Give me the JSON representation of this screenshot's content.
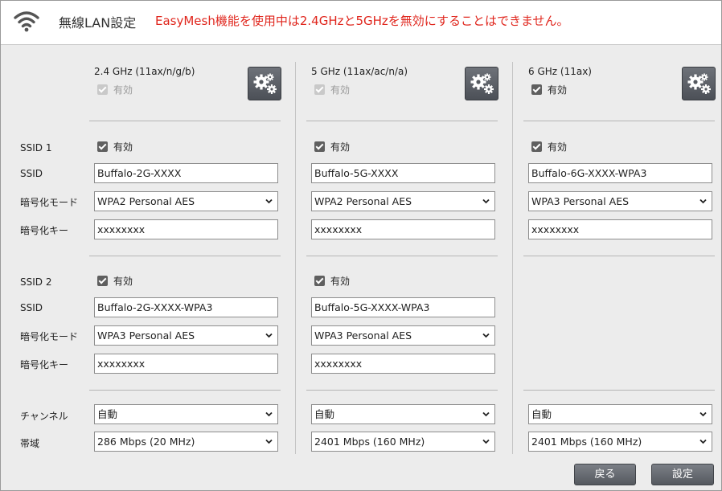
{
  "header": {
    "title": "無線LAN設定",
    "warning": "EasyMesh機能を使用中は2.4GHzと5GHzを無効にすることはできません。"
  },
  "labels": {
    "enabled": "有効",
    "ssid1": "SSID 1",
    "ssid2": "SSID 2",
    "ssid": "SSID",
    "encryption_mode": "暗号化モード",
    "encryption_key": "暗号化キー",
    "channel": "チャンネル",
    "bandwidth": "帯域"
  },
  "bands": [
    {
      "title": "2.4 GHz (11ax/n/g/b)",
      "ssid1": {
        "ssid": "Buffalo-2G-XXXX",
        "encryption": "WPA2 Personal AES",
        "key": "xxxxxxxx"
      },
      "ssid2": {
        "ssid": "Buffalo-2G-XXXX-WPA3",
        "encryption": "WPA3 Personal AES",
        "key": "xxxxxxxx"
      },
      "channel": "自動",
      "bandwidth": "286 Mbps (20 MHz)"
    },
    {
      "title": "5 GHz (11ax/ac/n/a)",
      "ssid1": {
        "ssid": "Buffalo-5G-XXXX",
        "encryption": "WPA2 Personal AES",
        "key": "xxxxxxxx"
      },
      "ssid2": {
        "ssid": "Buffalo-5G-XXXX-WPA3",
        "encryption": "WPA3 Personal AES",
        "key": "xxxxxxxx"
      },
      "channel": "自動",
      "bandwidth": "2401 Mbps (160 MHz)"
    },
    {
      "title": "6 GHz (11ax)",
      "ssid1": {
        "ssid": "Buffalo-6G-XXXX-WPA3",
        "encryption": "WPA3 Personal AES",
        "key": "xxxxxxxx"
      },
      "channel": "自動",
      "bandwidth": "2401 Mbps (160 MHz)"
    }
  ],
  "buttons": {
    "back": "戻る",
    "apply": "設定"
  },
  "colors": {
    "warning": "#e0261d",
    "button": "#5f6369",
    "panel_background": "#ececec"
  }
}
